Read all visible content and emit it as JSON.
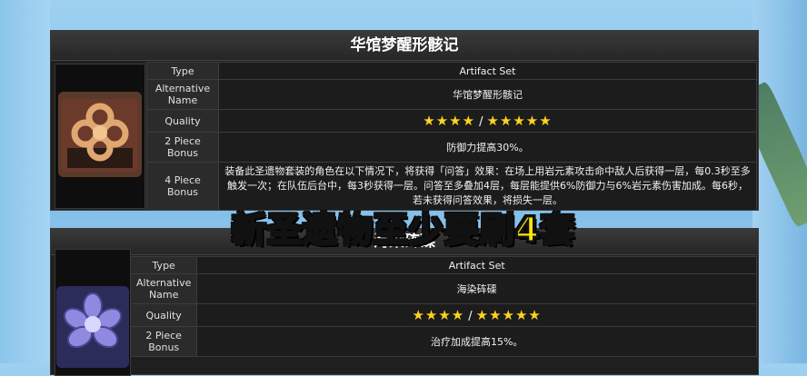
{
  "overlay_text": "新圣遗物至少要刷4套",
  "cards": [
    {
      "title": "华馆梦醒形骸记",
      "rows": {
        "type_label": "Type",
        "type_value": "Artifact Set",
        "alt_label": "Alternative Name",
        "alt_value": "华馆梦醒形骸记",
        "quality_label": "Quality",
        "quality_low": "★★★★",
        "quality_sep": "/",
        "quality_high": "★★★★★",
        "two_label": "2 Piece Bonus",
        "two_value": "防御力提高30%。",
        "four_label": "4 Piece Bonus",
        "four_value": "装备此圣遗物套装的角色在以下情况下，将获得「问答」效果：在场上用岩元素攻击命中敌人后获得一层，每0.3秒至多触发一次；在队伍后台中，每3秒获得一层。问答至多叠加4层，每层能提供6%防御力与6%岩元素伤害加成。每6秒，若未获得问答效果，将损失一层。"
      },
      "icon": "knot-flower-icon"
    },
    {
      "title": "海染砗磲",
      "rows": {
        "type_label": "Type",
        "type_value": "Artifact Set",
        "alt_label": "Alternative Name",
        "alt_value": "海染砗磲",
        "quality_label": "Quality",
        "quality_low": "★★★★",
        "quality_sep": "/",
        "quality_high": "★★★★★",
        "two_label": "2 Piece Bonus",
        "two_value": "治疗加成提高15%。"
      },
      "icon": "purple-flower-icon"
    }
  ],
  "colors": {
    "accent": "#e9a73a",
    "star": "#ffd21f",
    "overlay": "#ffe60a"
  }
}
